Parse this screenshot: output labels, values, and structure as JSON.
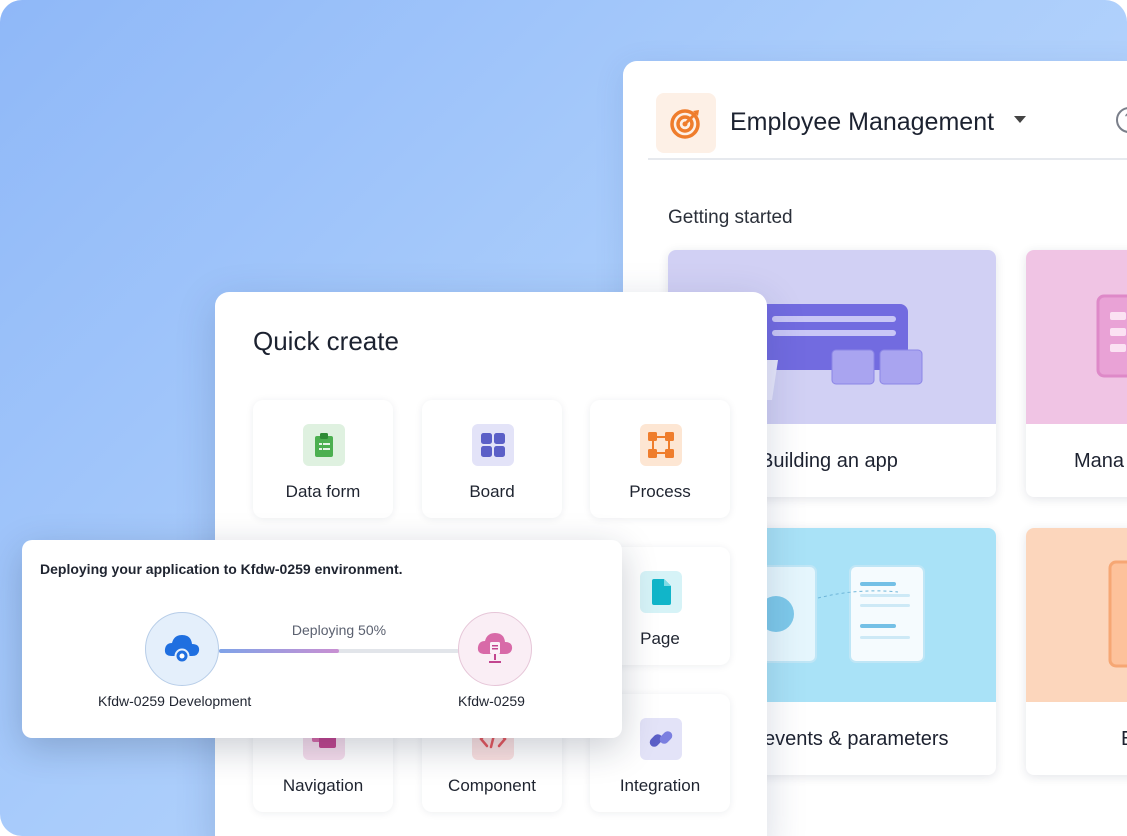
{
  "app": {
    "title": "Employee Management",
    "section_title": "Getting started",
    "cards": [
      {
        "label": "Building an app"
      },
      {
        "label": "Mana"
      },
      {
        "label": "events & parameters"
      },
      {
        "label": "E"
      }
    ]
  },
  "quick_create": {
    "title": "Quick create",
    "tiles": [
      {
        "label": "Data form",
        "icon": "clipboard-icon",
        "color": "#4caf50"
      },
      {
        "label": "Board",
        "icon": "grid-icon",
        "color": "#5b5fc7"
      },
      {
        "label": "Process",
        "icon": "process-icon",
        "color": "#ef7d2c"
      },
      {
        "label": "Page",
        "icon": "page-icon",
        "color": "#11b5c9"
      },
      {
        "label": "Navigation",
        "icon": "navigation-icon",
        "color": "#c2458f"
      },
      {
        "label": "Component",
        "icon": "code-icon",
        "color": "#e5575d"
      },
      {
        "label": "Integration",
        "icon": "link-icon",
        "color": "#5b5fc7"
      }
    ]
  },
  "deploy": {
    "message": "Deploying your application to Kfdw-0259 environment.",
    "progress_label": "Deploying 50%",
    "progress": 0.5,
    "source_label": "Kfdw-0259 Development",
    "target_label": "Kfdw-0259"
  },
  "colors": {
    "accent": "#ef7d2c",
    "background": "#a9ccfb"
  }
}
